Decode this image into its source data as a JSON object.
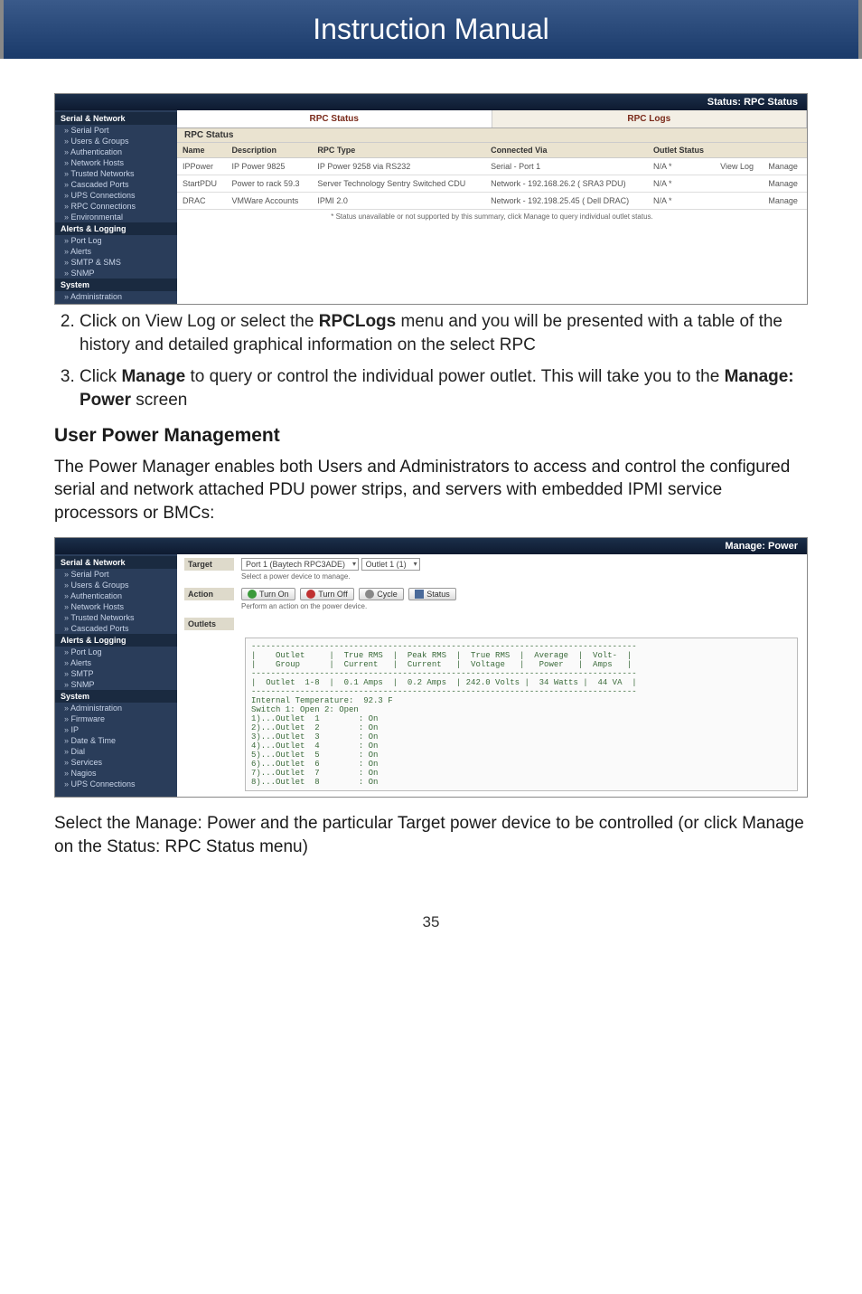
{
  "header": {
    "title": "Instruction Manual"
  },
  "shot1": {
    "titlebar": "Status: RPC Status",
    "sidebar": {
      "g1": {
        "head": "Serial & Network",
        "items": [
          "Serial Port",
          "Users & Groups",
          "Authentication",
          "Network Hosts",
          "Trusted Networks",
          "Cascaded Ports",
          "UPS Connections",
          "RPC Connections",
          "Environmental"
        ]
      },
      "g2": {
        "head": "Alerts & Logging",
        "items": [
          "Port Log",
          "Alerts",
          "SMTP & SMS",
          "SNMP"
        ]
      },
      "g3": {
        "head": "System",
        "items": [
          "Administration"
        ]
      }
    },
    "tabs": {
      "a": "RPC Status",
      "b": "RPC Logs"
    },
    "subhead": "RPC Status",
    "cols": {
      "name": "Name",
      "desc": "Description",
      "type": "RPC Type",
      "conn": "Connected Via",
      "out": "Outlet Status",
      "log": "",
      "mng": ""
    },
    "rows": [
      {
        "name": "IPPower",
        "desc": "IP Power 9825",
        "type": "IP Power 9258 via RS232",
        "conn": "Serial - Port 1",
        "out": "N/A *",
        "log": "View Log",
        "mng": "Manage"
      },
      {
        "name": "StartPDU",
        "desc": "Power to rack 59.3",
        "type": "Server Technology Sentry Switched CDU",
        "conn": "Network - 192.168.26.2 ( SRA3 PDU)",
        "out": "N/A *",
        "log": "",
        "mng": "Manage"
      },
      {
        "name": "DRAC",
        "desc": "VMWare Accounts",
        "type": "IPMI 2.0",
        "conn": "Network - 192.198.25.45 ( Dell DRAC)",
        "out": "N/A *",
        "log": "",
        "mng": "Manage"
      }
    ],
    "footnote": "* Status unavailable or not supported by this summary, click Manage to query individual outlet status."
  },
  "steps": {
    "s2_a": "Click on View Log or select the ",
    "s2_b": "RPCLogs",
    "s2_c": " menu and you will be presented with a table of the history and detailed graphical information on the select RPC",
    "s3_a": "Click ",
    "s3_b": "Manage",
    "s3_c": " to query or control the individual power outlet. This will take you to the ",
    "s3_d": "Manage: Power",
    "s3_e": " screen"
  },
  "section_heading": "User Power Management",
  "para1": "The Power Manager enables both Users and Administrators to access and control the configured serial and network attached PDU power strips, and servers with embedded IPMI service processors or BMCs:",
  "shot2": {
    "titlebar": "Manage: Power",
    "sidebar": {
      "g1": {
        "head": "Serial & Network",
        "items": [
          "Serial Port",
          "Users & Groups",
          "Authentication",
          "Network Hosts",
          "Trusted Networks",
          "Cascaded Ports"
        ]
      },
      "g2": {
        "head": "Alerts & Logging",
        "items": [
          "Port Log",
          "Alerts",
          "SMTP",
          "SNMP"
        ]
      },
      "g3": {
        "head": "System",
        "items": [
          "Administration",
          "Firmware",
          "IP",
          "Date & Time",
          "Dial",
          "Services",
          "Nagios",
          "UPS Connections"
        ]
      }
    },
    "target": {
      "label": "Target",
      "dd1": "Port 1 (Baytech RPC3ADE)",
      "dd2": "Outlet  1 (1)",
      "sub": "Select a power device to manage."
    },
    "action": {
      "label": "Action",
      "b1": "Turn On",
      "b2": "Turn Off",
      "b3": "Cycle",
      "b4": "Status",
      "sub": "Perform an action on the power device."
    },
    "outlets": {
      "label": "Outlets",
      "text": "-------------------------------------------------------------------------------\n|    Outlet     |  True RMS  |  Peak RMS  |  True RMS  |  Average  |  Volt-  |\n|    Group      |  Current   |  Current   |  Voltage   |   Power   |  Amps   |\n-------------------------------------------------------------------------------\n|  Outlet  1-8  |  0.1 Amps  |  0.2 Amps  | 242.0 Volts |  34 Watts |  44 VA  |\n-------------------------------------------------------------------------------\nInternal Temperature:  92.3 F\nSwitch 1: Open 2: Open\n1)...Outlet  1        : On\n2)...Outlet  2        : On\n3)...Outlet  3        : On\n4)...Outlet  4        : On\n5)...Outlet  5        : On\n6)...Outlet  6        : On\n7)...Outlet  7        : On\n8)...Outlet  8        : On"
    }
  },
  "para2": "Select the Manage: Power and the particular Target  power device to be controlled (or click Manage on the Status: RPC Status menu)",
  "page_number": "35"
}
